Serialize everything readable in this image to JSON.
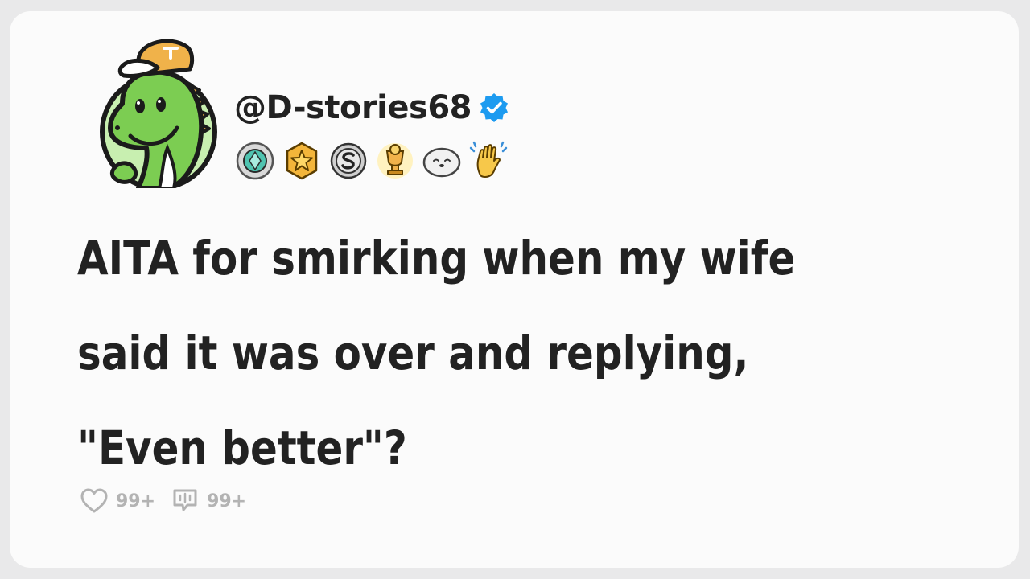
{
  "post": {
    "username": "@D-stories68",
    "title_lines": [
      "AITA for smirking when my wife",
      "said it was over and replying,",
      "\"Even better\"?"
    ]
  },
  "badges": [
    {
      "icon": "gem-badge-icon"
    },
    {
      "icon": "star-badge-icon"
    },
    {
      "icon": "s-coin-badge-icon"
    },
    {
      "icon": "trophy-badge-icon"
    },
    {
      "icon": "seal-badge-icon"
    },
    {
      "icon": "high-five-badge-icon"
    }
  ],
  "stats": {
    "likes": "99+",
    "comments": "99+"
  },
  "colors": {
    "background": "#fbfbfb",
    "text": "#222222",
    "muted": "#b3b3b3",
    "verified": "#1d9bf0",
    "avatar_green": "#7ccd52",
    "avatar_bg": "#c8efb0",
    "cap": "#e8a545"
  }
}
